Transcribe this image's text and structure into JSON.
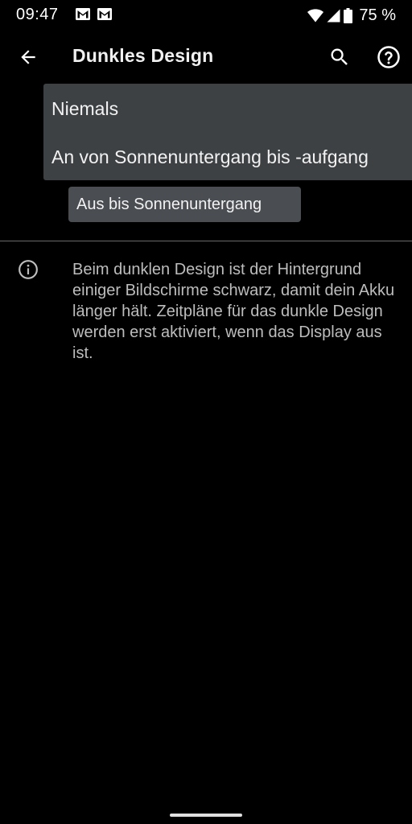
{
  "status_bar": {
    "time": "09:47",
    "battery": "75 %",
    "icons": [
      "gmail-icon",
      "gmail-icon",
      "wifi-icon",
      "cellular-signal-icon",
      "battery-icon"
    ]
  },
  "app_bar": {
    "title": "Dunkles Design",
    "icons": [
      "back-arrow-icon",
      "search-icon",
      "help-icon"
    ]
  },
  "dropdown": {
    "options": [
      "Niemals",
      "An von Sonnenuntergang bis -aufgang"
    ],
    "selected": "Aus bis Sonnenuntergang"
  },
  "info": {
    "icon": "info-icon",
    "text": "Beim dunklen Design ist der Hintergrund einiger Bildschirme schwarz, damit dein Akku länger hält. Zeitpläne für das dunkle Design werden erst aktiviert, wenn das Display aus ist."
  },
  "colors": {
    "background": "#000000",
    "menu_background": "#3e4144",
    "chip_background": "#4a4d51",
    "secondary_text": "#bdbdbd"
  }
}
